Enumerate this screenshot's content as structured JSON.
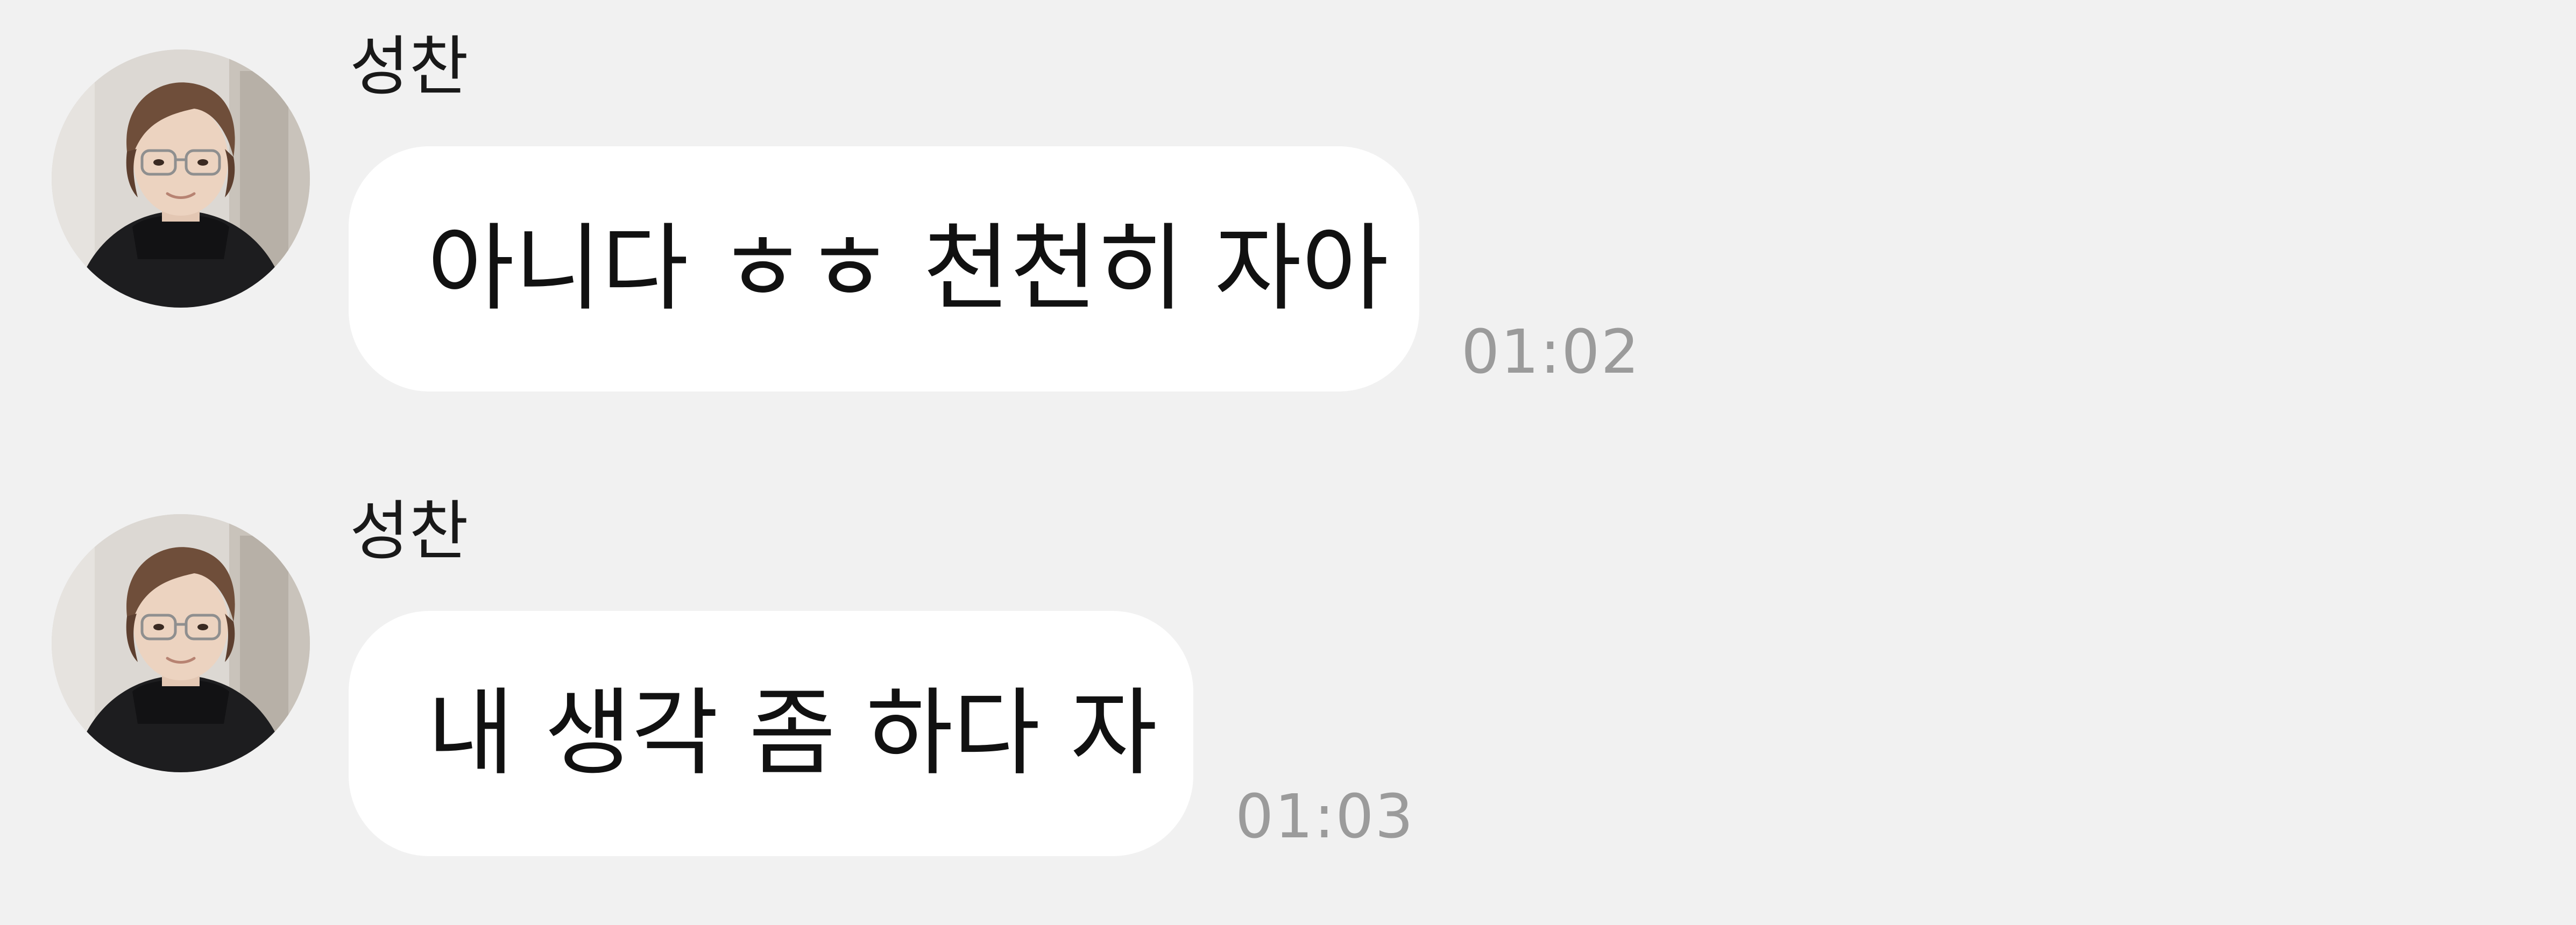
{
  "messages": [
    {
      "sender": "성찬",
      "text": "아니다 ㅎㅎ 천천히 자아",
      "time": "01:02"
    },
    {
      "sender": "성찬",
      "text": "내 생각 좀 하다 자",
      "time": "01:03"
    }
  ],
  "colors": {
    "background": "#f1f1f1",
    "bubble": "#ffffff",
    "text": "#111111",
    "timestamp": "#9b9b9b"
  }
}
